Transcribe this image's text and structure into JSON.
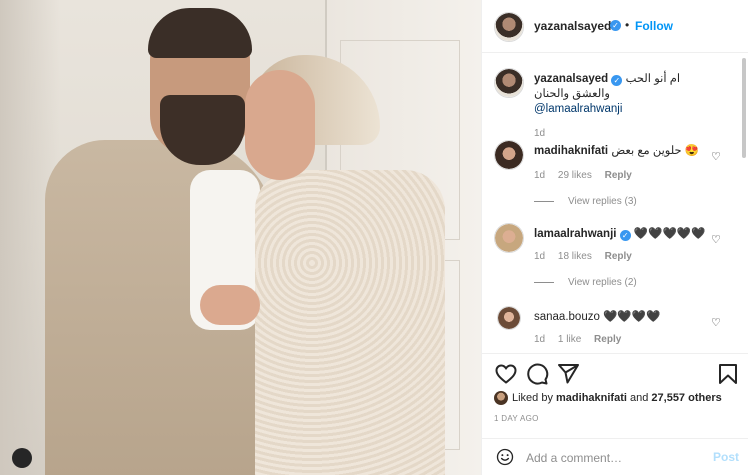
{
  "post": {
    "author": "yazanalsayed",
    "follow_label": "Follow",
    "dot": "•",
    "verified_icon": "✓"
  },
  "caption": {
    "user": "yazanalsayed",
    "text": "ام أنو الحب والعشق والحنان",
    "mention": "@lamaalrahwanji",
    "age": "1d"
  },
  "comments": [
    {
      "user": "madihaknifati",
      "text": "حلوين مع بعض 😍",
      "age": "1d",
      "likes": "29 likes",
      "reply": "Reply",
      "view_replies": "View replies (3)",
      "verified": false
    },
    {
      "user": "lamaalrahwanji",
      "text": "🖤🖤🖤🖤🖤",
      "age": "1d",
      "likes": "18 likes",
      "reply": "Reply",
      "view_replies": "View replies (2)",
      "verified": true
    },
    {
      "user": "sanaa.bouzo",
      "text": "🖤🖤🖤🖤",
      "age": "1d",
      "likes": "1 like",
      "reply": "Reply",
      "verified": false
    }
  ],
  "likes": {
    "liked_by_prefix": "Liked by ",
    "liked_by_user": "madihaknifati",
    "and": " and ",
    "others": "27,557 others"
  },
  "timestamp": "1 DAY AGO",
  "add_comment": {
    "placeholder": "Add a comment…",
    "post_label": "Post"
  },
  "icons": {
    "heart": "heart-icon",
    "comment": "comment-icon",
    "share": "share-icon",
    "save": "bookmark-icon",
    "emoji": "emoji-icon",
    "more": "more-icon"
  },
  "colors": {
    "accent": "#0095f6",
    "verified": "#3897f0",
    "muted": "#8e8e8e",
    "post_disabled": "#b2dffc"
  }
}
